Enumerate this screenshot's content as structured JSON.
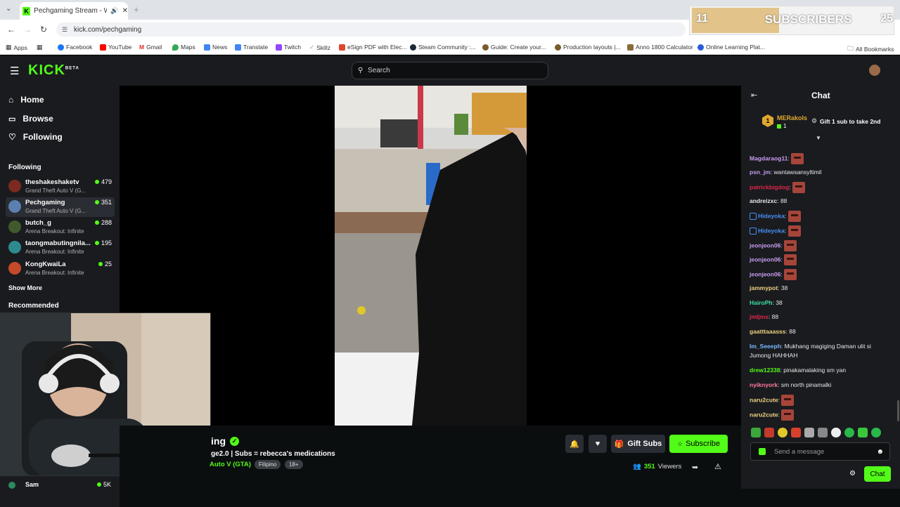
{
  "browser": {
    "tab_title": "Pechgaming Stream - Watc",
    "url": "kick.com/pechgaming",
    "bookmarks": [
      "Apps",
      "Facebook",
      "YouTube",
      "Gmail",
      "Maps",
      "News",
      "Translate",
      "Twitch",
      "Skillz",
      "eSign PDF with Elec...",
      "Steam Community :...",
      "Guide: Create your...",
      "Production layouts |...",
      "Anno 1800 Calculator",
      "Online Learning Plat..."
    ],
    "all_bookmarks": "All Bookmarks"
  },
  "overlay": {
    "left_count": "11",
    "label": "SUBSCRIBERS",
    "right_count": "25"
  },
  "header": {
    "logo": "KICK",
    "logo_sup": "BETA",
    "search_placeholder": "Search"
  },
  "sidebar": {
    "nav": [
      "Home",
      "Browse",
      "Following"
    ],
    "following_label": "Following",
    "channels": [
      {
        "name": "theshakeshaketv",
        "game": "Grand Theft Auto V (G...",
        "viewers": "479",
        "color": "#7a2a1f"
      },
      {
        "name": "Pechgaming",
        "game": "Grand Theft Auto V (G...",
        "viewers": "351",
        "color": "#5a7fb0"
      },
      {
        "name": "butch_g",
        "game": "Arena Breakout: Infinite",
        "viewers": "288",
        "color": "#3f5a2c"
      },
      {
        "name": "taongmabutingnila...",
        "game": "Arena Breakout: Infinite",
        "viewers": "195",
        "color": "#2d8b8f"
      },
      {
        "name": "KongKwaiLa",
        "game": "Arena Breakout: Infinite",
        "viewers": "25",
        "color": "#c44a2a"
      }
    ],
    "show_more": "Show More",
    "recommended_label": "Recommended",
    "bottom_channel": {
      "name": "Sam",
      "viewers": "5K"
    }
  },
  "stream": {
    "name_partial": "ing",
    "title_partial": "ge2.0 | Subs = rebecca's medications",
    "game_partial": "Auto V (GTA)",
    "tags": [
      "Filipino",
      "18+"
    ],
    "gift_label": "Gift Subs",
    "subscribe_label": "Subscribe",
    "viewers": "351",
    "viewers_label": "Viewers"
  },
  "chat": {
    "title": "Chat",
    "pinned": {
      "user": "MERakols",
      "count": "1",
      "rank": "1",
      "text": "Gift 1 sub to take 2nd"
    },
    "messages": [
      {
        "user": "Magdaraog11",
        "color": "#c89cf0",
        "text": "",
        "emote": true
      },
      {
        "user": "psn_jm",
        "color": "#c89cf0",
        "text": "wantawsansyltimil",
        "emote": false
      },
      {
        "user": "patrickbigdog",
        "color": "#e0264a",
        "text": "",
        "emote": true
      },
      {
        "user": "andreizxc",
        "color": "#e8e8e8",
        "text": "88",
        "emote": false
      },
      {
        "user": "Hideyoka",
        "color": "#4a8ef0",
        "text": "",
        "emote": true,
        "badge": true
      },
      {
        "user": "Hideyoka",
        "color": "#4a8ef0",
        "text": "",
        "emote": true,
        "badge": true
      },
      {
        "user": "jeonjeon06",
        "color": "#c89cf0",
        "text": "",
        "emote": true
      },
      {
        "user": "jeonjeon06",
        "color": "#c89cf0",
        "text": "",
        "emote": true
      },
      {
        "user": "jeonjeon06",
        "color": "#c89cf0",
        "text": "",
        "emote": true
      },
      {
        "user": "jammypot",
        "color": "#f0d080",
        "text": "38",
        "emote": false
      },
      {
        "user": "HairoPh",
        "color": "#3ee0a0",
        "text": "38",
        "emote": false
      },
      {
        "user": "jmljms",
        "color": "#e0264a",
        "text": "88",
        "emote": false
      },
      {
        "user": "gaatttaaasss",
        "color": "#f0d080",
        "text": "88",
        "emote": false
      },
      {
        "user": "Im_Seeeph",
        "color": "#7ab8ff",
        "text": "Mukhang magiging Daman ulit si Jumong HAHHAH",
        "emote": false
      },
      {
        "user": "drew12338",
        "color": "#53fc18",
        "text": "pinakamalaking sm yan",
        "emote": false
      },
      {
        "user": "nyiknyork",
        "color": "#ff7a9a",
        "text": "sm north pinamalki",
        "emote": false
      },
      {
        "user": "naru2cute",
        "color": "#f0d080",
        "text": "",
        "emote": true
      },
      {
        "user": "naru2cute",
        "color": "#f0d080",
        "text": "",
        "emote": true
      }
    ],
    "input_placeholder": "Send a message",
    "send_label": "Chat"
  }
}
